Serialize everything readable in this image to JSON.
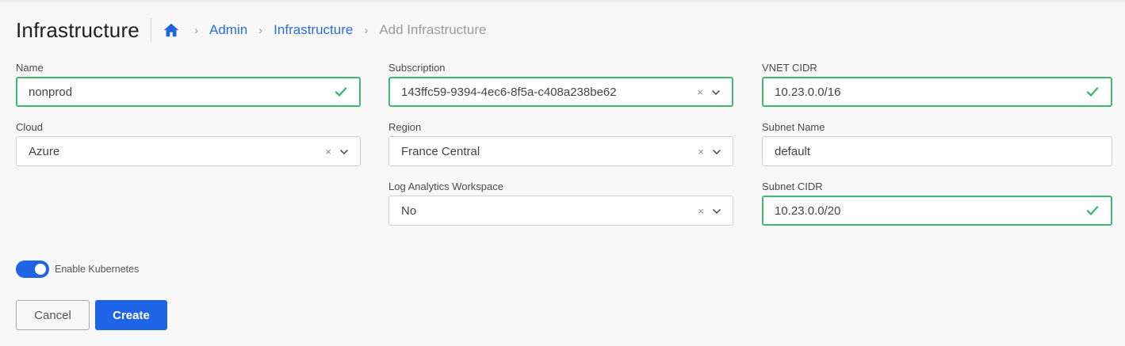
{
  "header": {
    "title": "Infrastructure",
    "breadcrumb": [
      {
        "label": "Admin"
      },
      {
        "label": "Infrastructure"
      },
      {
        "label": "Add Infrastructure"
      }
    ]
  },
  "form": {
    "name": {
      "label": "Name",
      "value": "nonprod"
    },
    "cloud": {
      "label": "Cloud",
      "value": "Azure"
    },
    "subscription": {
      "label": "Subscription",
      "value": "143ffc59-9394-4ec6-8f5a-c408a238be62"
    },
    "region": {
      "label": "Region",
      "value": "France Central"
    },
    "log_analytics": {
      "label": "Log Analytics Workspace",
      "value": "No"
    },
    "vnet_cidr": {
      "label": "VNET CIDR",
      "value": "10.23.0.0/16"
    },
    "subnet_name": {
      "label": "Subnet Name",
      "value": "default"
    },
    "subnet_cidr": {
      "label": "Subnet CIDR",
      "value": "10.23.0.0/20"
    },
    "clear_glyph": "×",
    "enable_kubernetes": {
      "label": "Enable Kubernetes",
      "checked": true
    }
  },
  "actions": {
    "cancel_label": "Cancel",
    "create_label": "Create"
  },
  "colors": {
    "accent": "#1f64e6",
    "link": "#2a6fdb",
    "valid": "#3cba6e"
  },
  "icons": [
    "home-icon",
    "check-icon",
    "chevron-down-icon",
    "clear-icon"
  ]
}
